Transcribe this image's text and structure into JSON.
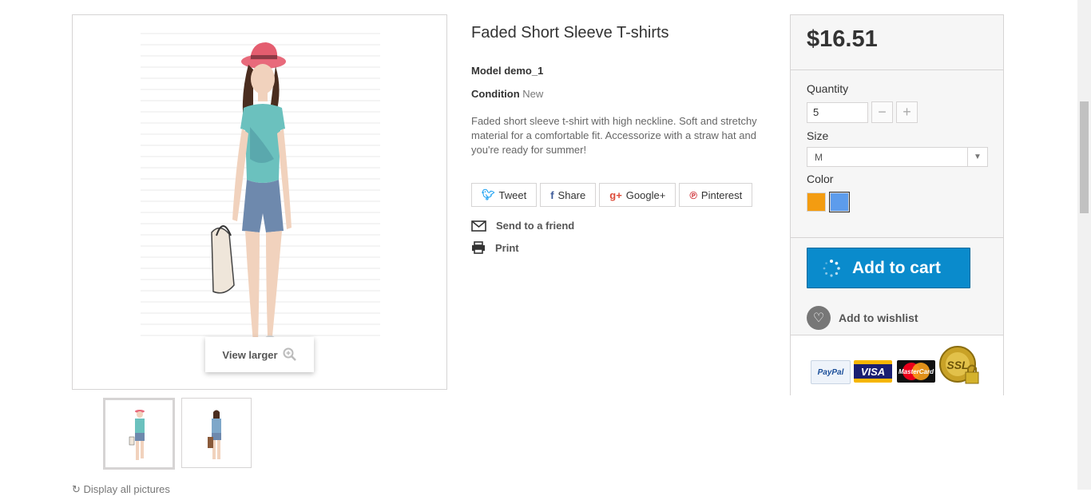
{
  "product": {
    "title": "Faded Short Sleeve T-shirts",
    "model_label": "Model",
    "model_value": "demo_1",
    "condition_label": "Condition",
    "condition_value": "New",
    "description": "Faded short sleeve t-shirt with high neckline. Soft and stretchy material for a comfortable fit. Accessorize with a straw hat and you're ready for summer!"
  },
  "image": {
    "view_larger_label": "View larger",
    "display_all_label": "Display all pictures",
    "thumbnails": [
      "thumb-1",
      "thumb-2"
    ]
  },
  "social": {
    "tweet": "Tweet",
    "share": "Share",
    "google": "Google+",
    "pinterest": "Pinterest"
  },
  "links": {
    "send_friend": "Send to a friend",
    "print": "Print"
  },
  "buy": {
    "price": "$16.51",
    "quantity_label": "Quantity",
    "quantity_value": "5",
    "size_label": "Size",
    "size_value": "M",
    "color_label": "Color",
    "colors": [
      "#f39c11",
      "#5d9cec"
    ],
    "add_to_cart": "Add to cart",
    "wishlist": "Add to wishlist"
  },
  "payments": {
    "paypal": "PayPal",
    "visa": "VISA",
    "mastercard": "MasterCard",
    "ssl": "SSL"
  }
}
